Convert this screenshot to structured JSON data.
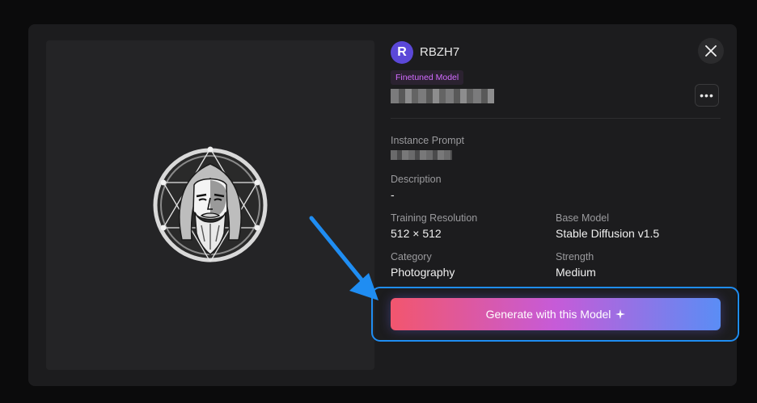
{
  "user": {
    "avatar_letter": "R",
    "name": "RBZH7"
  },
  "badge": {
    "label": "Finetuned Model"
  },
  "fields": {
    "instance_prompt": {
      "label": "Instance Prompt"
    },
    "description": {
      "label": "Description",
      "value": "-"
    },
    "training_resolution": {
      "label": "Training Resolution",
      "value": "512 × 512"
    },
    "base_model": {
      "label": "Base Model",
      "value": "Stable Diffusion v1.5"
    },
    "category": {
      "label": "Category",
      "value": "Photography"
    },
    "strength": {
      "label": "Strength",
      "value": "Medium"
    }
  },
  "actions": {
    "more": "•••",
    "generate_label": "Generate with this Model"
  },
  "icons": {
    "close": "close-icon",
    "more": "more-horizontal-icon",
    "sparkle": "sparkle-icon",
    "logo": "bearded-man-geometric-logo",
    "annotation": "blue-arrow-annotation"
  },
  "colors": {
    "accent_gradient": [
      "#f2566e",
      "#c65bd8",
      "#5a8df5"
    ],
    "avatar": "#5b48d8",
    "badge_text": "#d26bff",
    "highlight": "#1f8df2"
  }
}
